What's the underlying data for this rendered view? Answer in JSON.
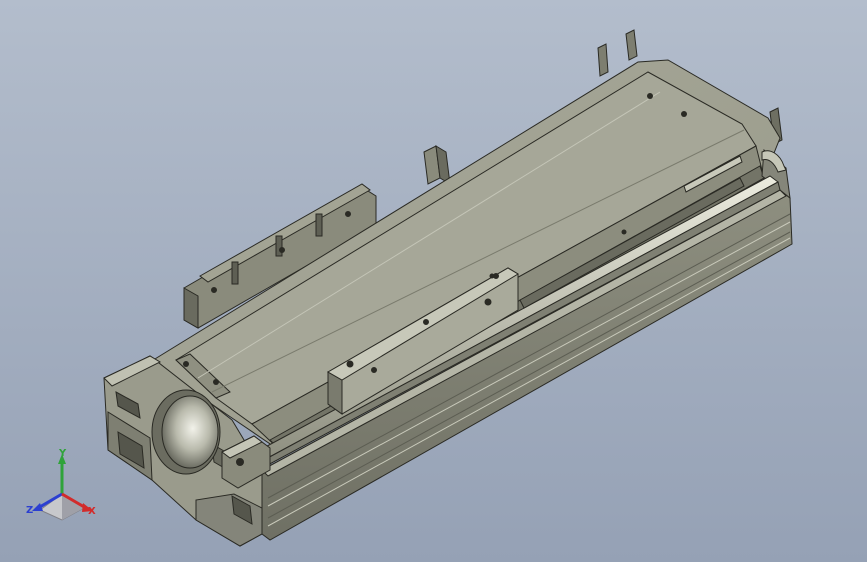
{
  "viewport": {
    "background_top": "#b3bdcc",
    "background_bottom": "#95a1b5"
  },
  "model": {
    "name": "linear-actuator-module",
    "body_color": "#9b9c8c",
    "highlight_color": "#d9dace",
    "shadow_color": "#5c5d52",
    "edge_color": "#2a2a24"
  },
  "triad": {
    "y_label": "Y",
    "z_label": "Z",
    "x_label": "X",
    "y_color": "#2fa33a",
    "z_color": "#2b3fd1",
    "x_color": "#d22b2b"
  }
}
